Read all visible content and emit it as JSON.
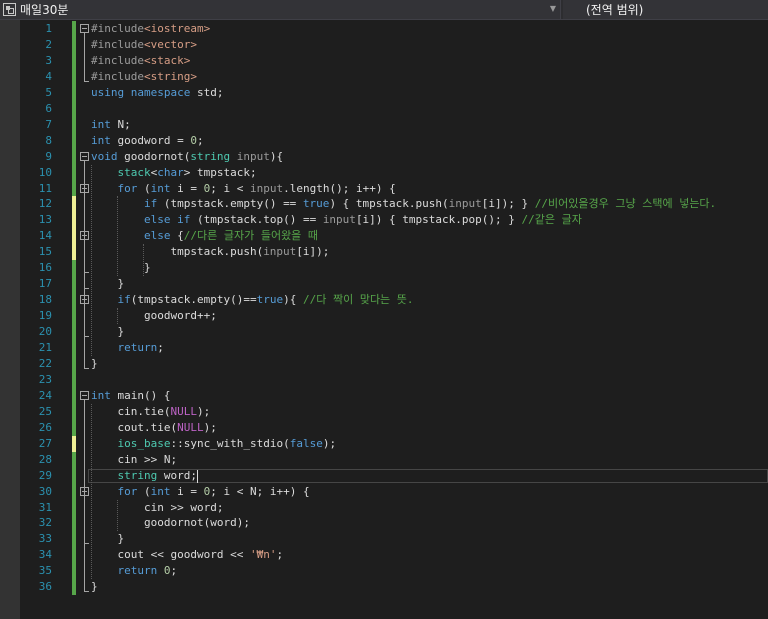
{
  "toolbar": {
    "scope_label": "매일30분",
    "member_label": "(전역 범위)"
  },
  "lines": [
    {
      "n": "1",
      "code": [
        [
          "inc",
          "#include"
        ],
        [
          "str",
          "<iostream>"
        ]
      ]
    },
    {
      "n": "2",
      "code": [
        [
          "inc",
          "#include"
        ],
        [
          "str",
          "<vector>"
        ]
      ]
    },
    {
      "n": "3",
      "code": [
        [
          "inc",
          "#include"
        ],
        [
          "str",
          "<stack>"
        ]
      ]
    },
    {
      "n": "4",
      "code": [
        [
          "inc",
          "#include"
        ],
        [
          "str",
          "<string>"
        ]
      ]
    },
    {
      "n": "5",
      "code": [
        [
          "kw",
          "using"
        ],
        [
          "id",
          " "
        ],
        [
          "kw",
          "namespace"
        ],
        [
          "id",
          " std;"
        ]
      ]
    },
    {
      "n": "6",
      "code": []
    },
    {
      "n": "7",
      "code": [
        [
          "kw",
          "int"
        ],
        [
          "id",
          " N;"
        ]
      ]
    },
    {
      "n": "8",
      "code": [
        [
          "kw",
          "int"
        ],
        [
          "id",
          " goodword = "
        ],
        [
          "num",
          "0"
        ],
        [
          "id",
          ";"
        ]
      ]
    },
    {
      "n": "9",
      "code": [
        [
          "kw",
          "void"
        ],
        [
          "id",
          " goodornot("
        ],
        [
          "ty",
          "string"
        ],
        [
          "id",
          " "
        ],
        [
          "prm",
          "input"
        ],
        [
          "id",
          "){"
        ]
      ]
    },
    {
      "n": "10",
      "code": [
        [
          "id",
          "    "
        ],
        [
          "ty",
          "stack"
        ],
        [
          "id",
          "<"
        ],
        [
          "kw",
          "char"
        ],
        [
          "id",
          "> tmpstack;"
        ]
      ]
    },
    {
      "n": "11",
      "code": [
        [
          "id",
          "    "
        ],
        [
          "kw",
          "for"
        ],
        [
          "id",
          " ("
        ],
        [
          "kw",
          "int"
        ],
        [
          "id",
          " i = "
        ],
        [
          "num",
          "0"
        ],
        [
          "id",
          "; i < "
        ],
        [
          "prm",
          "input"
        ],
        [
          "id",
          ".length(); i++) {"
        ]
      ]
    },
    {
      "n": "12",
      "code": [
        [
          "id",
          "        "
        ],
        [
          "kw",
          "if"
        ],
        [
          "id",
          " (tmpstack.empty() == "
        ],
        [
          "kw",
          "true"
        ],
        [
          "id",
          ") { tmpstack.push("
        ],
        [
          "prm",
          "input"
        ],
        [
          "id",
          "[i]); } "
        ],
        [
          "cmt",
          "//비어있을경우 그냥 스택에 넣는다."
        ]
      ]
    },
    {
      "n": "13",
      "code": [
        [
          "id",
          "        "
        ],
        [
          "kw",
          "else"
        ],
        [
          "id",
          " "
        ],
        [
          "kw",
          "if"
        ],
        [
          "id",
          " (tmpstack.top() == "
        ],
        [
          "prm",
          "input"
        ],
        [
          "id",
          "[i]) { tmpstack.pop(); } "
        ],
        [
          "cmt",
          "//같은 글자"
        ]
      ]
    },
    {
      "n": "14",
      "code": [
        [
          "id",
          "        "
        ],
        [
          "kw",
          "else"
        ],
        [
          "id",
          " {"
        ],
        [
          "cmt",
          "//다른 글자가 들어왔을 때"
        ]
      ]
    },
    {
      "n": "15",
      "code": [
        [
          "id",
          "            tmpstack.push("
        ],
        [
          "prm",
          "input"
        ],
        [
          "id",
          "[i]);"
        ]
      ]
    },
    {
      "n": "16",
      "code": [
        [
          "id",
          "        }"
        ]
      ]
    },
    {
      "n": "17",
      "code": [
        [
          "id",
          "    }"
        ]
      ]
    },
    {
      "n": "18",
      "code": [
        [
          "id",
          "    "
        ],
        [
          "kw",
          "if"
        ],
        [
          "id",
          "(tmpstack.empty()=="
        ],
        [
          "kw",
          "true"
        ],
        [
          "id",
          "){ "
        ],
        [
          "cmt",
          "//다 짝이 맞다는 뜻."
        ]
      ]
    },
    {
      "n": "19",
      "code": [
        [
          "id",
          "        goodword++;"
        ]
      ]
    },
    {
      "n": "20",
      "code": [
        [
          "id",
          "    }"
        ]
      ]
    },
    {
      "n": "21",
      "code": [
        [
          "id",
          "    "
        ],
        [
          "kw",
          "return"
        ],
        [
          "id",
          ";"
        ]
      ]
    },
    {
      "n": "22",
      "code": [
        [
          "id",
          "}"
        ]
      ]
    },
    {
      "n": "23",
      "code": []
    },
    {
      "n": "24",
      "code": [
        [
          "kw",
          "int"
        ],
        [
          "id",
          " main() {"
        ]
      ]
    },
    {
      "n": "25",
      "code": [
        [
          "id",
          "    cin.tie("
        ],
        [
          "mac",
          "NULL"
        ],
        [
          "id",
          ");"
        ]
      ]
    },
    {
      "n": "26",
      "code": [
        [
          "id",
          "    cout.tie("
        ],
        [
          "mac",
          "NULL"
        ],
        [
          "id",
          ");"
        ]
      ]
    },
    {
      "n": "27",
      "code": [
        [
          "id",
          "    "
        ],
        [
          "ty",
          "ios_base"
        ],
        [
          "id",
          "::sync_with_stdio("
        ],
        [
          "kw",
          "false"
        ],
        [
          "id",
          ");"
        ]
      ]
    },
    {
      "n": "28",
      "code": [
        [
          "id",
          "    cin >> N;"
        ]
      ]
    },
    {
      "n": "29",
      "code": [
        [
          "id",
          "    "
        ],
        [
          "ty",
          "string"
        ],
        [
          "id",
          " word;"
        ]
      ]
    },
    {
      "n": "30",
      "code": [
        [
          "id",
          "    "
        ],
        [
          "kw",
          "for"
        ],
        [
          "id",
          " ("
        ],
        [
          "kw",
          "int"
        ],
        [
          "id",
          " i = "
        ],
        [
          "num",
          "0"
        ],
        [
          "id",
          "; i < N; i++) {"
        ]
      ]
    },
    {
      "n": "31",
      "code": [
        [
          "id",
          "        cin >> word;"
        ]
      ]
    },
    {
      "n": "32",
      "code": [
        [
          "id",
          "        goodornot(word);"
        ]
      ]
    },
    {
      "n": "33",
      "code": [
        [
          "id",
          "    }"
        ]
      ]
    },
    {
      "n": "34",
      "code": [
        [
          "id",
          "    cout << goodword << "
        ],
        [
          "str",
          "'₩n'"
        ],
        [
          "id",
          ";"
        ]
      ]
    },
    {
      "n": "35",
      "code": [
        [
          "id",
          "    "
        ],
        [
          "kw",
          "return"
        ],
        [
          "id",
          " "
        ],
        [
          "num",
          "0"
        ],
        [
          "id",
          ";"
        ]
      ]
    },
    {
      "n": "36",
      "code": [
        [
          "id",
          "}"
        ]
      ]
    }
  ],
  "unsaved_lines": [
    "12",
    "13",
    "14",
    "15",
    "27"
  ],
  "current_line": "29",
  "icons": [
    "project-icon",
    "chevron-down-icon",
    "collapse-toggle-icon"
  ]
}
